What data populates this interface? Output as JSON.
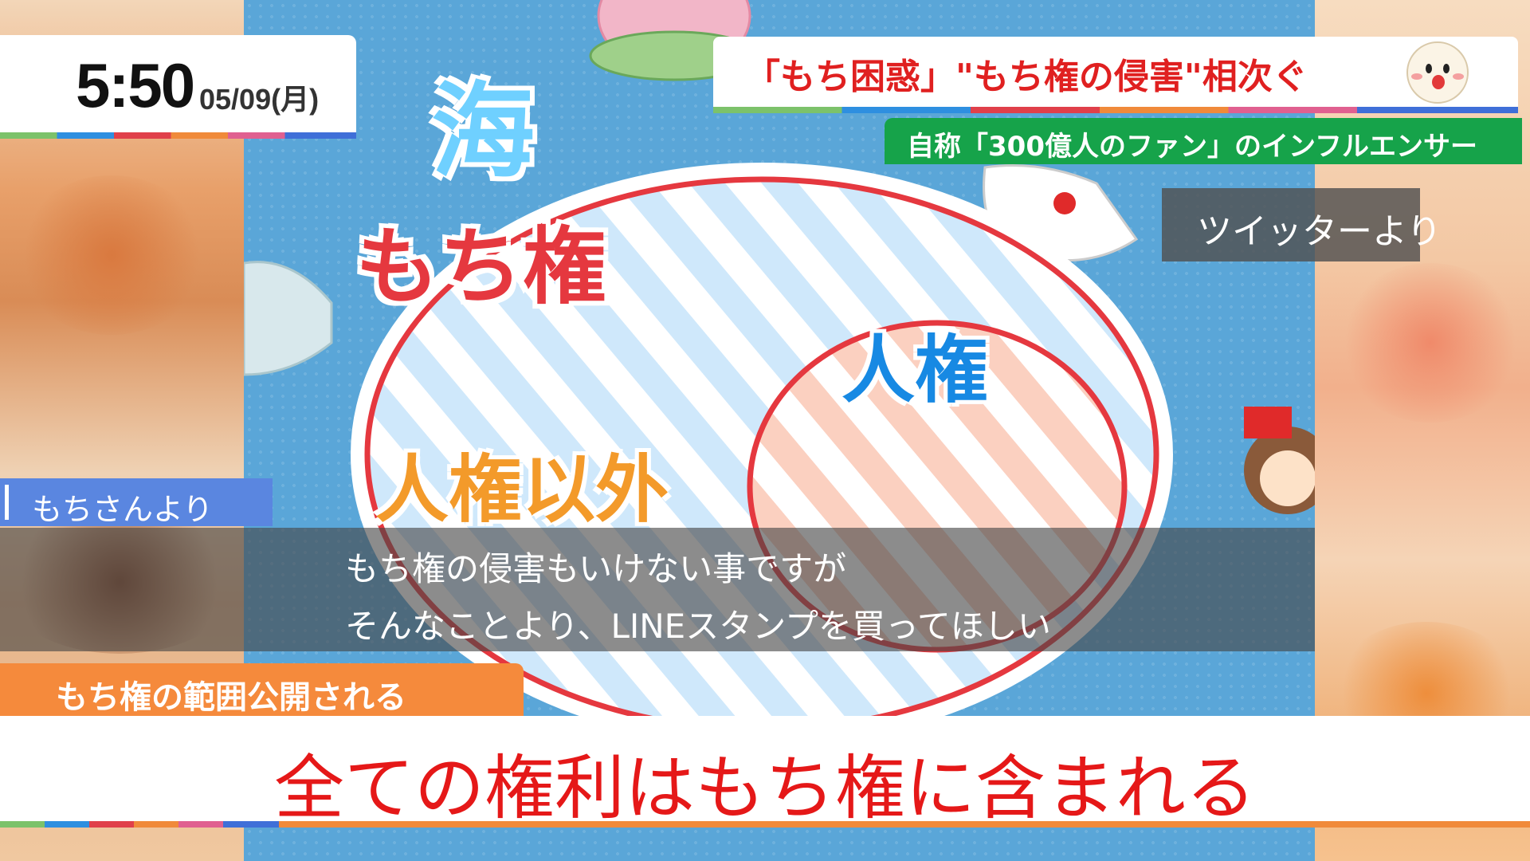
{
  "clock": {
    "time": "5:50",
    "date": "05/09(月)"
  },
  "headline": {
    "text": "「もち困惑」\"もち権の侵害\"相次ぐ"
  },
  "subheadline": {
    "text": "自称「300億人のファン」のインフルエンサー"
  },
  "source_label": {
    "text": "ツイッターより"
  },
  "speaker": {
    "text": "もちさんより"
  },
  "subtitles": {
    "line1": "もち権の侵害もいけない事ですが",
    "line2": "そんなことより、LINEスタンプを買ってほしい"
  },
  "topic_bar": {
    "text": "もち権の範囲公開される"
  },
  "caption": {
    "text": "全ての権利はもち権に含まれる"
  },
  "illustration": {
    "label_sea": "海",
    "label_mochiken": "もち権",
    "label_jinken": "人権",
    "label_igai": "人権以外"
  },
  "colors": {
    "headline_red": "#e02020",
    "subhead_green": "#16a34a",
    "topic_orange": "#f58a3c",
    "speaker_blue": "#5a86e0",
    "caption_red": "#e51818"
  }
}
